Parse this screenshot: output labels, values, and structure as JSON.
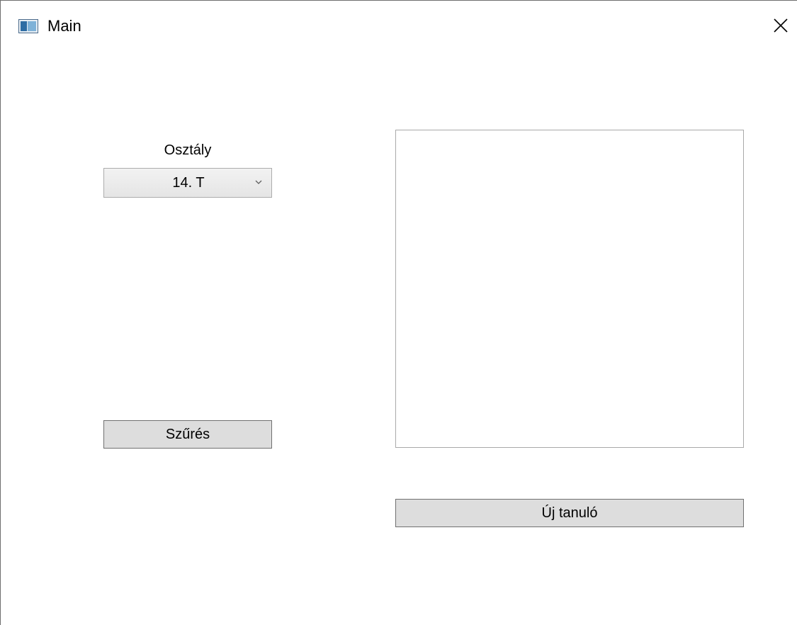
{
  "window": {
    "title": "Main",
    "icon": "app-window-icon",
    "close_icon": "close-icon"
  },
  "form": {
    "class_label": "Osztály",
    "class_select": {
      "selected": "14. T",
      "icon": "chevron-down-icon"
    },
    "filter_button": "Szűrés",
    "new_student_button": "Új tanuló",
    "student_list": []
  }
}
